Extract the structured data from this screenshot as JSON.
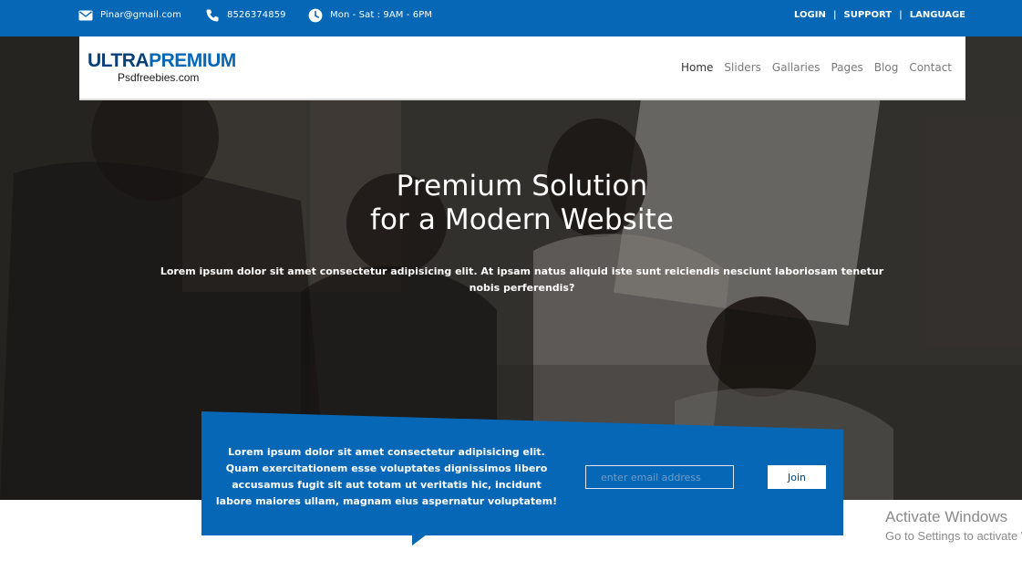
{
  "topbar": {
    "email": "Pinar@gmail.com",
    "phone": "8526374859",
    "hours": "Mon - Sat : 9AM - 6PM",
    "email_icon": "mail-icon",
    "phone_icon": "phone-icon",
    "clock_icon": "clock-icon",
    "links": [
      "LOGIN",
      "SUPPORT",
      "LANGUAGE"
    ]
  },
  "brand": {
    "logo_main": "ULTRA",
    "logo_accent": "PREMIUM",
    "logo_sub": "Psdfreebies.com"
  },
  "nav": {
    "items": [
      "Home",
      "Sliders",
      "Gallaries",
      "Pages",
      "Blog",
      "Contact"
    ],
    "active": "Home"
  },
  "hero": {
    "title_line1": "Premium Solution",
    "title_line2": "for a Modern Website",
    "description": "Lorem ipsum dolor sit amet consectetur adipisicing elit. At ipsam natus aliquid iste sunt reiciendis nesciunt laboriosam tenetur nobis perferendis?"
  },
  "newsletter": {
    "text": "Lorem ipsum dolor sit amet consectetur adipisicing elit. Quam exercitationem esse voluptates dignissimos libero accusamus fugit sit aut totam ut veritatis hic, incidunt labore maiores ullam, magnam eius aspernatur voluptatem!",
    "email_placeholder": "enter email address",
    "button_label": "Join"
  },
  "watermark": {
    "line1": "Activate Windows",
    "line2": "Go to Settings to activate Windows."
  },
  "colors": {
    "brand_blue": "#0567b6",
    "dark_blue": "#0a3f77",
    "white": "#ffffff"
  }
}
